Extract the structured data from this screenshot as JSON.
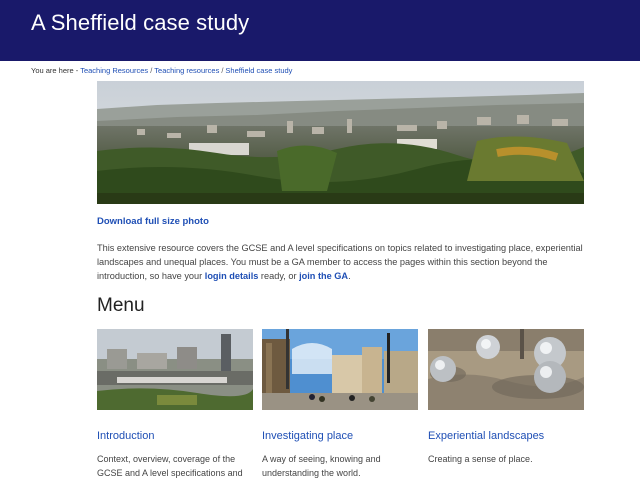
{
  "header": {
    "title": "A Sheffield case study"
  },
  "breadcrumb": {
    "prefix": "You are here -",
    "items": [
      "Teaching Resources",
      "Teaching resources",
      "Sheffield case study"
    ],
    "separator": "/"
  },
  "download_link": "Download full size photo",
  "intro": {
    "part1": "This extensive resource covers the GCSE and A level specifications on topics related to investigating place, experiential landscapes and unequal places. You must be a GA member to access the pages within this section beyond the introduction, so have your ",
    "link1": "login details",
    "part2": " ready, or ",
    "link2": "join the GA",
    "part3": "."
  },
  "menu": {
    "heading": "Menu",
    "cards": [
      {
        "title": "Introduction",
        "desc": "Context, overview, coverage of the GCSE and A level specifications and"
      },
      {
        "title": "Investigating place",
        "desc": "A way of seeing, knowing and understanding the world."
      },
      {
        "title": "Experiential landscapes",
        "desc": "Creating a sense of place."
      }
    ]
  },
  "colors": {
    "header_bg": "#19196a",
    "link": "#1f4fb5"
  }
}
